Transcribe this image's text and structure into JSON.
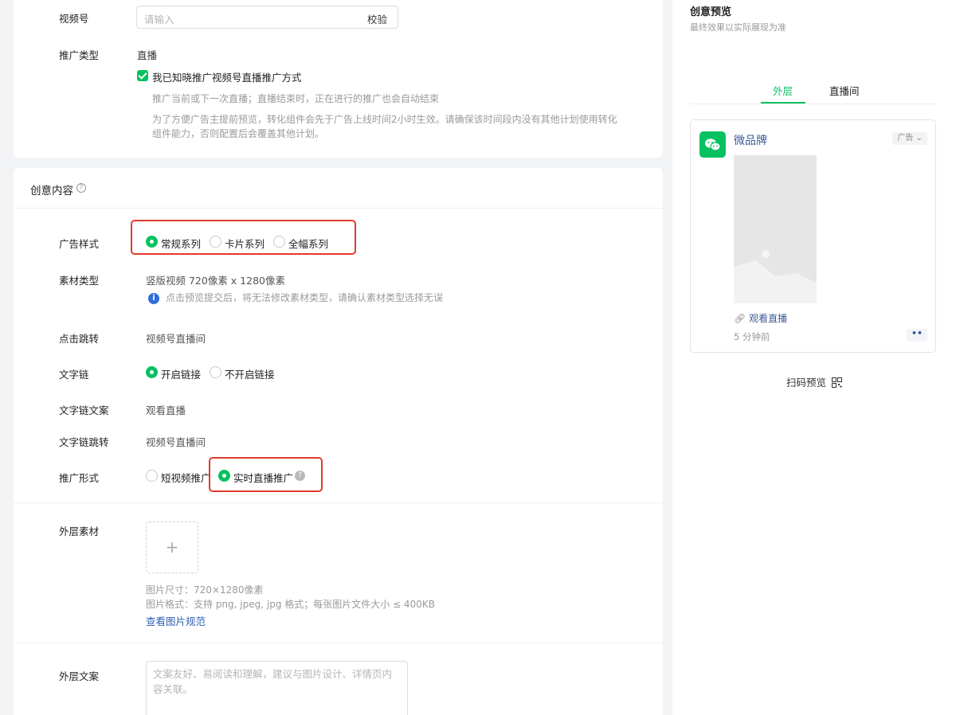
{
  "top_section": {
    "channel_label": "视频号",
    "channel_placeholder": "请输入",
    "channel_verify": "校验",
    "promo_type_label": "推广类型",
    "promo_type_value": "直播",
    "ack_checkbox_label": "我已知晓推广视频号直播推广方式",
    "hint_1": "推广当前或下一次直播；直播结束时，正在进行的推广也会自动结束",
    "hint_2_line1": "为了方便广告主提前预览，转化组件会先于广告上线时间2小时生效。请确保该时间段内没有其他计划使用转化",
    "hint_2_line2": "组件能力，否则配置后会覆盖其他计划。"
  },
  "creative": {
    "title": "创意内容",
    "help_icon": "question-circle-icon",
    "ad_style_label": "广告样式",
    "ad_style_options": [
      "常规系列",
      "卡片系列",
      "全幅系列"
    ],
    "ad_style_selected": "常规系列",
    "material_type_label": "素材类型",
    "material_type_value": "竖版视频 720像素 x 1280像素",
    "material_type_note": "点击预览提交后，将无法修改素材类型，请确认素材类型选择无误",
    "click_jump_label": "点击跳转",
    "click_jump_value": "视频号直播间",
    "text_link_label": "文字链",
    "text_link_options": [
      "开启链接",
      "不开启链接"
    ],
    "text_link_selected": "开启链接",
    "text_link_copy_label": "文字链文案",
    "text_link_copy_value": "观看直播",
    "text_link_jump_label": "文字链跳转",
    "text_link_jump_value": "视频号直播间",
    "promo_form_label": "推广形式",
    "promo_form_options": [
      "短视频推广",
      "实时直播推广"
    ],
    "promo_form_selected": "实时直播推广",
    "outer_material_label": "外层素材",
    "upload_icon": "plus-icon",
    "image_size_note": "图片尺寸：720×1280像素",
    "image_format_note": "图片格式：支持 png, jpeg, jpg 格式；每张图片文件大小 ≤ 400KB",
    "image_spec_link": "查看图片规范",
    "outer_copy_label": "外层文案",
    "outer_copy_placeholder": "文案友好、易阅读和理解，建议与图片设计、详情页内容关联。"
  },
  "preview": {
    "title": "创意预览",
    "subtitle": "最终效果以实际展现为准",
    "tabs": [
      "外层",
      "直播间"
    ],
    "active_tab": "外层",
    "brand_name": "微品牌",
    "ad_tag": "广告",
    "watch_live": "观看直播",
    "time_ago": "5 分钟前",
    "more_dots": "••",
    "scan_preview": "扫码预览",
    "icons": [
      "wechat-logo-icon",
      "link-icon",
      "chevron-down-icon",
      "qrcode-icon",
      "image-placeholder-icon"
    ],
    "accent_color": "#07c160",
    "link_color": "#3a5a98"
  },
  "annotation_color": "#e23a2e"
}
